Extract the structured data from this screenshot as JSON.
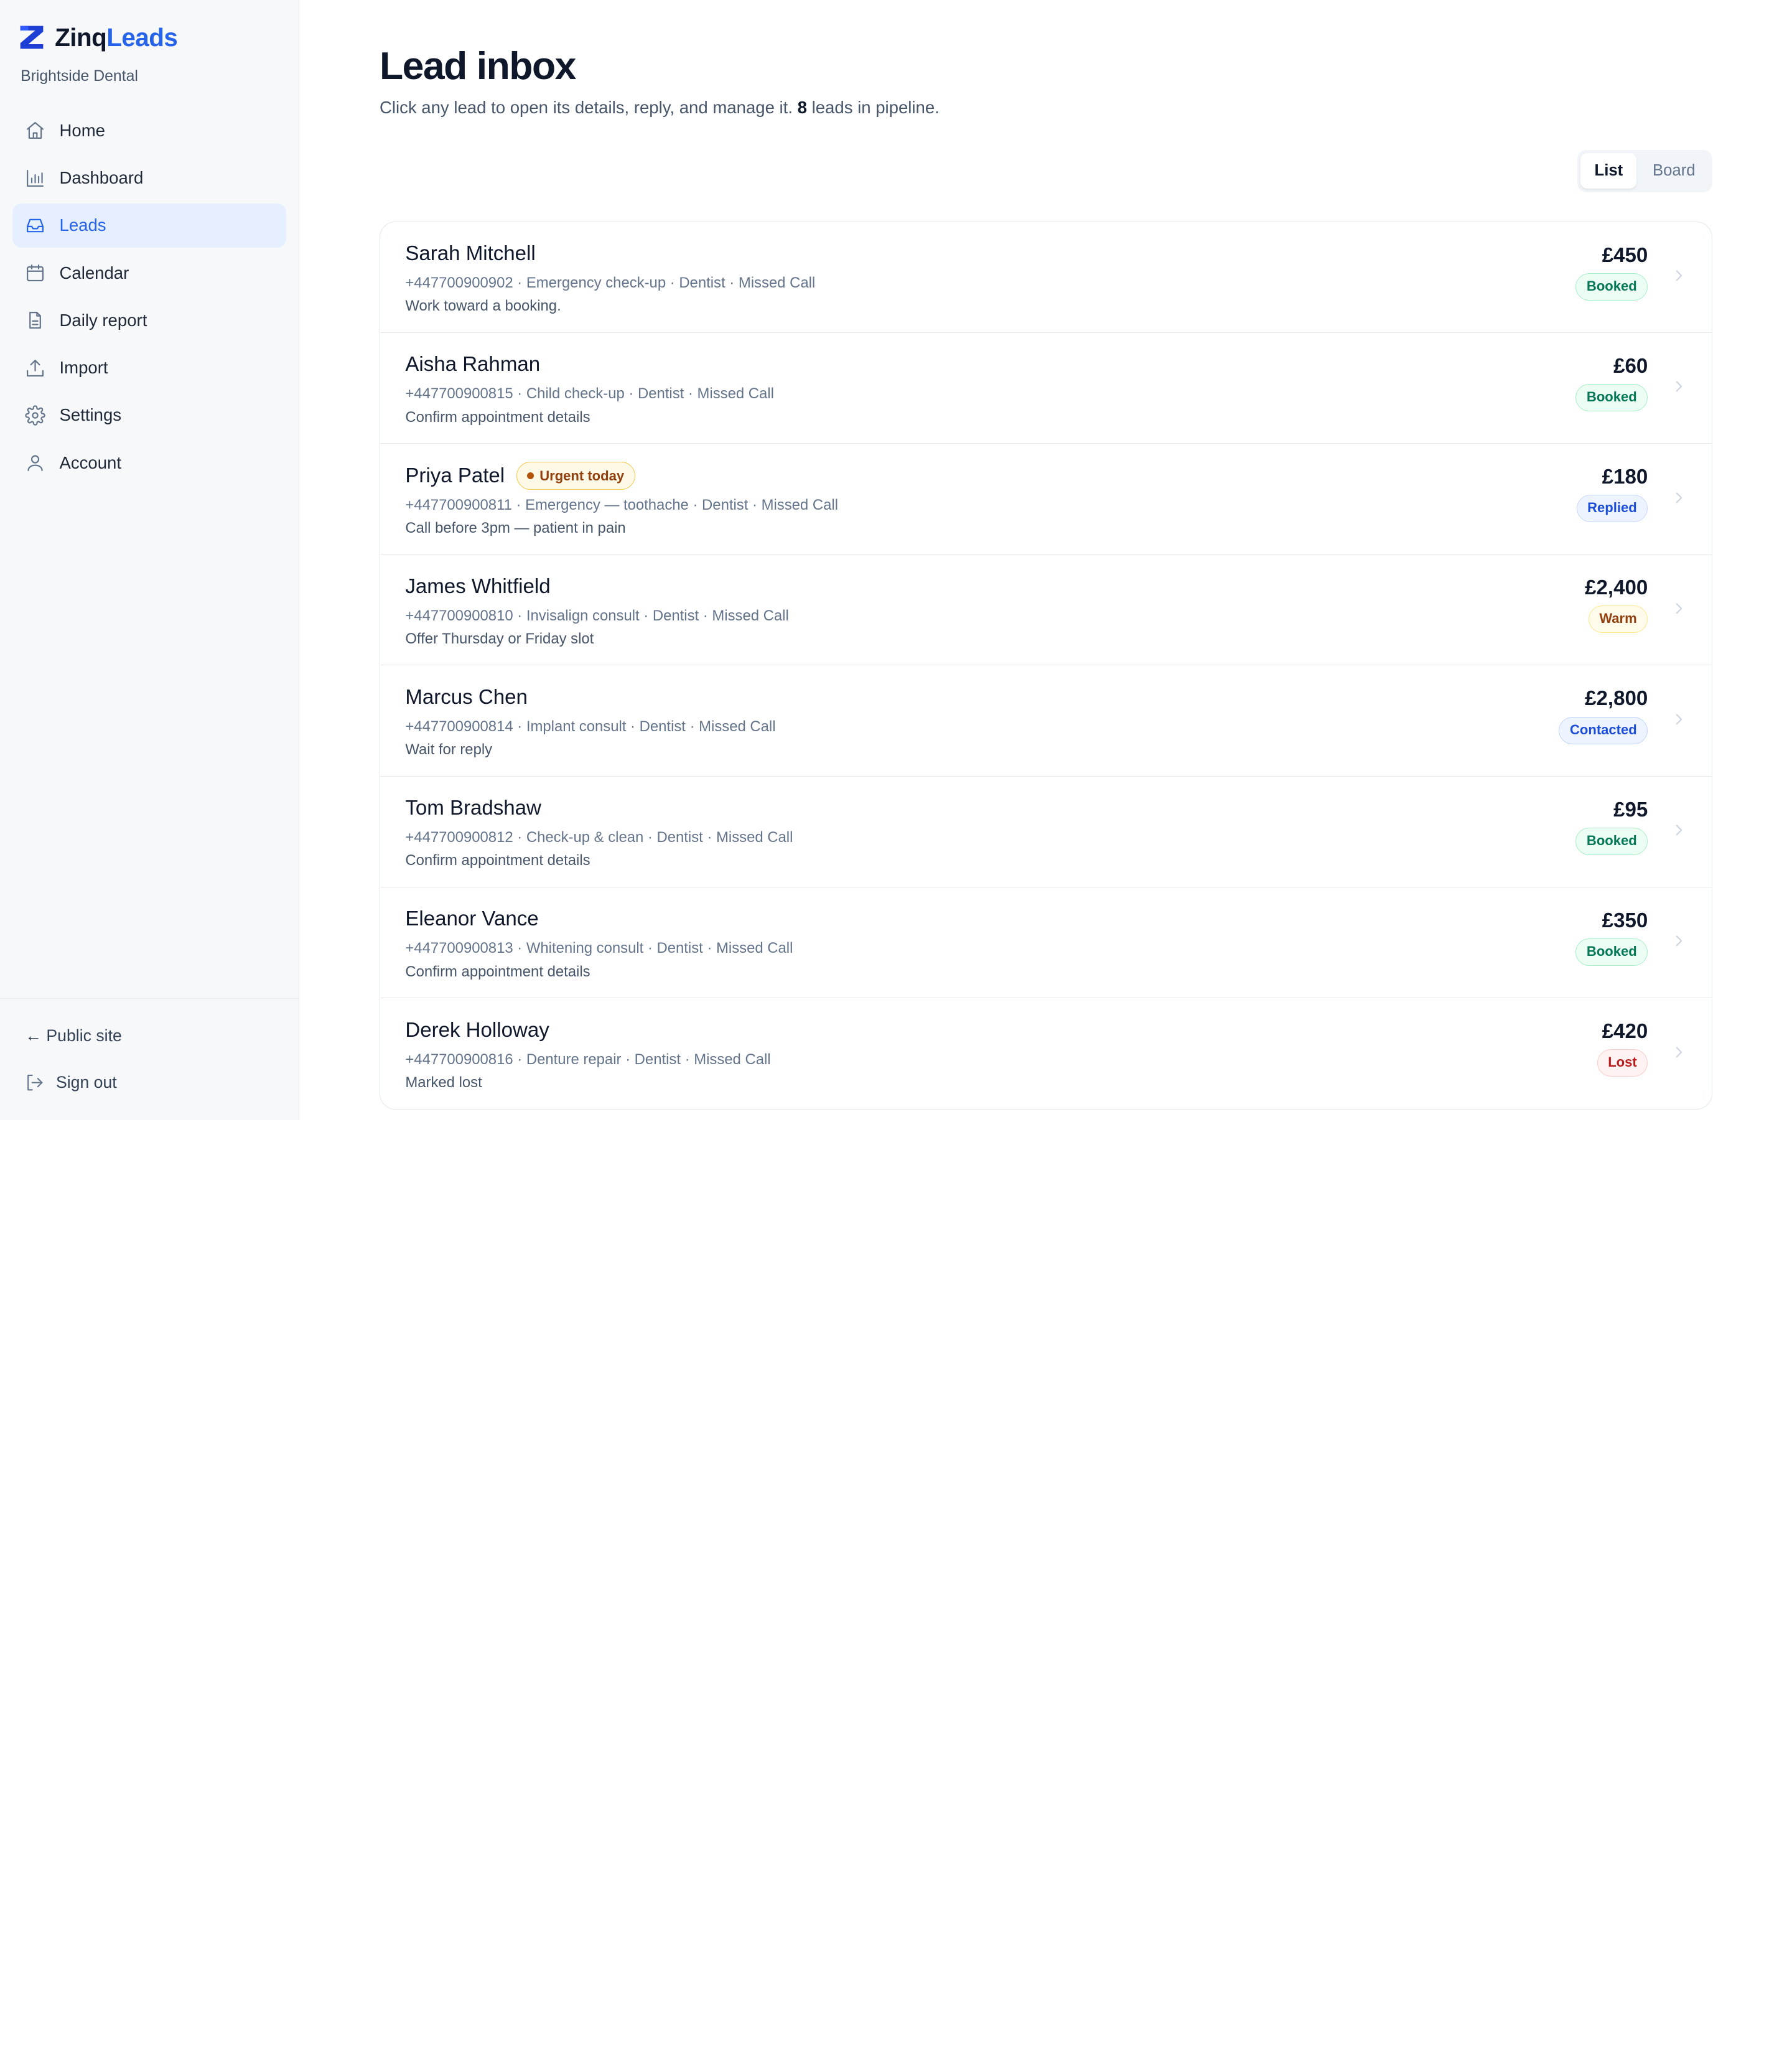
{
  "brand": {
    "name_part1": "Zinq",
    "name_part2": "Leads",
    "org": "Brightside Dental"
  },
  "nav": {
    "items": [
      {
        "label": "Home",
        "icon": "home-icon"
      },
      {
        "label": "Dashboard",
        "icon": "bar-chart-icon"
      },
      {
        "label": "Leads",
        "icon": "inbox-icon",
        "active": true
      },
      {
        "label": "Calendar",
        "icon": "calendar-icon"
      },
      {
        "label": "Daily report",
        "icon": "document-icon"
      },
      {
        "label": "Import",
        "icon": "upload-icon"
      },
      {
        "label": "Settings",
        "icon": "gear-icon"
      },
      {
        "label": "Account",
        "icon": "user-icon"
      }
    ]
  },
  "footer": {
    "public_site": "← Public site",
    "sign_out": "Sign out"
  },
  "header": {
    "title": "Lead inbox",
    "subtitle_before": "Click any lead to open its details, reply, and manage it. ",
    "lead_count": "8",
    "subtitle_after": " leads in pipeline."
  },
  "view_toggle": {
    "list": "List",
    "board": "Board",
    "selected": "List"
  },
  "leads": [
    {
      "name": "Sarah Mitchell",
      "meta": "+447700900902 · Emergency check-up · Dentist · Missed Call",
      "note": "Work toward a booking.",
      "value": "£450",
      "status": "Booked",
      "status_kind": "booked"
    },
    {
      "name": "Aisha Rahman",
      "meta": "+447700900815 · Child check-up · Dentist · Missed Call",
      "note": "Confirm appointment details",
      "value": "£60",
      "status": "Booked",
      "status_kind": "booked"
    },
    {
      "name": "Priya Patel",
      "badge": "Urgent today",
      "meta": "+447700900811 · Emergency — toothache · Dentist · Missed Call",
      "note": "Call before 3pm — patient in pain",
      "value": "£180",
      "status": "Replied",
      "status_kind": "replied"
    },
    {
      "name": "James Whitfield",
      "meta": "+447700900810 · Invisalign consult · Dentist · Missed Call",
      "note": "Offer Thursday or Friday slot",
      "value": "£2,400",
      "status": "Warm",
      "status_kind": "warm"
    },
    {
      "name": "Marcus Chen",
      "meta": "+447700900814 · Implant consult · Dentist · Missed Call",
      "note": "Wait for reply",
      "value": "£2,800",
      "status": "Contacted",
      "status_kind": "contacted"
    },
    {
      "name": "Tom Bradshaw",
      "meta": "+447700900812 · Check-up & clean · Dentist · Missed Call",
      "note": "Confirm appointment details",
      "value": "£95",
      "status": "Booked",
      "status_kind": "booked"
    },
    {
      "name": "Eleanor Vance",
      "meta": "+447700900813 · Whitening consult · Dentist · Missed Call",
      "note": "Confirm appointment details",
      "value": "£350",
      "status": "Booked",
      "status_kind": "booked"
    },
    {
      "name": "Derek Holloway",
      "meta": "+447700900816 · Denture repair · Dentist · Missed Call",
      "note": "Marked lost",
      "value": "£420",
      "status": "Lost",
      "status_kind": "lost"
    }
  ]
}
